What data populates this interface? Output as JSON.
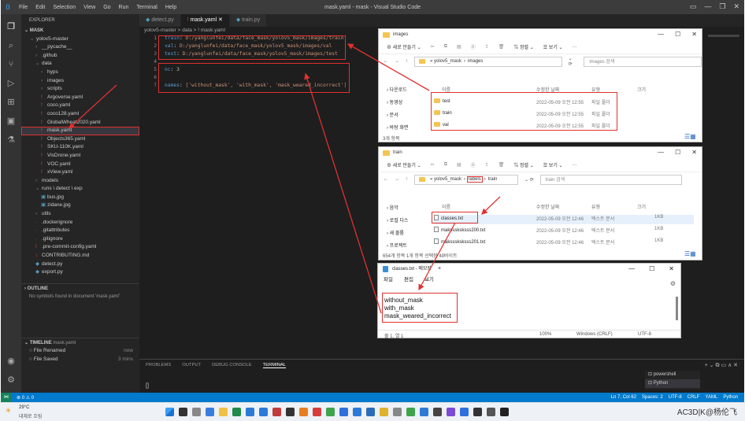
{
  "vscode": {
    "title": "mask.yaml - mask - Visual Studio Code",
    "menu": [
      "File",
      "Edit",
      "Selection",
      "View",
      "Go",
      "Run",
      "Terminal",
      "Help"
    ],
    "explorer_header": "EXPLORER",
    "root": "MASK",
    "tree": [
      {
        "label": "yolov5-master",
        "indent": 1,
        "icon": "chevron-down",
        "kind": "folder"
      },
      {
        "label": "__pycache__",
        "indent": 2,
        "icon": "chevron-right",
        "kind": "folder"
      },
      {
        "label": ".github",
        "indent": 2,
        "icon": "chevron-right",
        "kind": "folder"
      },
      {
        "label": "data",
        "indent": 2,
        "icon": "chevron-down",
        "kind": "folder"
      },
      {
        "label": "hyps",
        "indent": 3,
        "icon": "chevron-right",
        "kind": "folder"
      },
      {
        "label": "images",
        "indent": 3,
        "icon": "chevron-right",
        "kind": "folder"
      },
      {
        "label": "scripts",
        "indent": 3,
        "icon": "chevron-right",
        "kind": "folder"
      },
      {
        "label": "Argoverse.yaml",
        "indent": 3,
        "icon": "!",
        "kind": "yaml"
      },
      {
        "label": "coco.yaml",
        "indent": 3,
        "icon": "!",
        "kind": "yaml"
      },
      {
        "label": "coco128.yaml",
        "indent": 3,
        "icon": "!",
        "kind": "yaml"
      },
      {
        "label": "GlobalWheat2020.yaml",
        "indent": 3,
        "icon": "!",
        "kind": "yaml"
      },
      {
        "label": "mask.yaml",
        "indent": 3,
        "icon": "!",
        "kind": "yaml",
        "selected": true
      },
      {
        "label": "Objects365.yaml",
        "indent": 3,
        "icon": "!",
        "kind": "yaml"
      },
      {
        "label": "SKU-110K.yaml",
        "indent": 3,
        "icon": "!",
        "kind": "yaml"
      },
      {
        "label": "VisDrone.yaml",
        "indent": 3,
        "icon": "!",
        "kind": "yaml"
      },
      {
        "label": "VOC.yaml",
        "indent": 3,
        "icon": "!",
        "kind": "yaml"
      },
      {
        "label": "xView.yaml",
        "indent": 3,
        "icon": "!",
        "kind": "yaml"
      },
      {
        "label": "models",
        "indent": 2,
        "icon": "chevron-right",
        "kind": "folder"
      },
      {
        "label": "runs \\ detect \\ exp",
        "indent": 2,
        "icon": "chevron-down",
        "kind": "folder"
      },
      {
        "label": "bus.jpg",
        "indent": 3,
        "icon": "img",
        "kind": "image"
      },
      {
        "label": "zidane.jpg",
        "indent": 3,
        "icon": "img",
        "kind": "image"
      },
      {
        "label": "utils",
        "indent": 2,
        "icon": "chevron-right",
        "kind": "folder"
      },
      {
        "label": ".dockerignore",
        "indent": 2,
        "icon": "",
        "kind": "file"
      },
      {
        "label": ".gitattributes",
        "indent": 2,
        "icon": "",
        "kind": "file"
      },
      {
        "label": ".gitignore",
        "indent": 2,
        "icon": "",
        "kind": "file"
      },
      {
        "label": ".pre-commit-config.yaml",
        "indent": 2,
        "icon": "!",
        "kind": "yaml"
      },
      {
        "label": "CONTRIBUTING.md",
        "indent": 2,
        "icon": "M",
        "kind": "md"
      },
      {
        "label": "detect.py",
        "indent": 2,
        "icon": "py",
        "kind": "py"
      },
      {
        "label": "export.py",
        "indent": 2,
        "icon": "py",
        "kind": "py"
      }
    ],
    "outline_header": "OUTLINE",
    "outline_empty": "No symbols found in document 'mask.yaml'",
    "timeline_header": "TIMELINE",
    "timeline_file": "mask.yaml",
    "timeline": [
      {
        "label": "File Renamed",
        "time": "now"
      },
      {
        "label": "File Saved",
        "time": "3 mins"
      }
    ],
    "tabs": [
      {
        "label": "detect.py",
        "active": false
      },
      {
        "label": "mask.yaml",
        "active": true
      },
      {
        "label": "train.py",
        "active": false
      }
    ],
    "breadcrumb": "yolov5-master > data > ! mask.yaml",
    "code": [
      {
        "ln": "1",
        "key": "train",
        "val": " D:/yanglunfei/data/face_mask/yolov5_mask/images/train"
      },
      {
        "ln": "2",
        "key": "val",
        "val": " D:/yanglunfei/data/face_mask/yolov5_mask/images/val"
      },
      {
        "ln": "3",
        "key": "test",
        "val": " D:/yanglunfei/data/face_mask/yolov5_mask/images/test"
      },
      {
        "ln": "4",
        "key": "",
        "val": ""
      },
      {
        "ln": "5",
        "key": "nc",
        "val": " 3"
      },
      {
        "ln": "6",
        "key": "",
        "val": ""
      },
      {
        "ln": "7",
        "key": "names",
        "val": " ['without_mask', 'with_mask', 'mask_weared_incorrect']"
      }
    ],
    "panel_tabs": [
      "PROBLEMS",
      "OUTPUT",
      "DEBUG CONSOLE",
      "TERMINAL"
    ],
    "terminal_prompt": "[]",
    "terminals": [
      "powershell",
      "Python"
    ],
    "status_left": "⊗ 0 ⚠ 0",
    "status_right": [
      "Ln 7, Col 62",
      "Spaces: 2",
      "UTF-8",
      "CRLF",
      "YAML",
      "Python"
    ]
  },
  "images_window": {
    "title": "images",
    "new_btn": "새로 만들기",
    "sort": "정렬",
    "view": "보기",
    "address": [
      "« yolov5_mask",
      "images"
    ],
    "search_placeholder": "images 검색",
    "col_name": "이름",
    "col_date": "수정한 날짜",
    "col_type": "유형",
    "col_size": "크기",
    "nav": [
      "다운로드",
      "동영상",
      "문서",
      "바탕 화면"
    ],
    "files": [
      {
        "name": "test",
        "date": "2022-05-09 오전 12:55",
        "type": "파일 폴더"
      },
      {
        "name": "train",
        "date": "2022-05-09 오전 12:55",
        "type": "파일 폴더"
      },
      {
        "name": "val",
        "date": "2022-05-09 오전 12:55",
        "type": "파일 폴더"
      }
    ],
    "status": "3개 항목"
  },
  "train_window": {
    "title": "train",
    "new_btn": "새로 만들기",
    "sort": "정렬",
    "view": "보기",
    "address": [
      "« yolov5_mask",
      "labels",
      "train"
    ],
    "search_placeholder": "train 검색",
    "col_name": "이름",
    "col_date": "수정한 날짜",
    "col_type": "유형",
    "col_size": "크기",
    "nav": [
      "음악",
      "로컬 디스",
      "새 볼륨",
      "프로젝트"
    ],
    "files": [
      {
        "name": "classes.txt",
        "date": "2022-05-09 오전 12:46",
        "type": "텍스트 문서",
        "size": "1KB"
      },
      {
        "name": "maksssksksss200.txt",
        "date": "2022-05-09 오전 12:46",
        "type": "텍스트 문서",
        "size": "1KB"
      },
      {
        "name": "maksssksksss201.txt",
        "date": "2022-05-09 오전 12:46",
        "type": "텍스트 문서",
        "size": "1KB"
      }
    ],
    "status": "654개 항목    1개 항목 선택함 48바이트"
  },
  "notepad": {
    "title": "classes.txt - 메모장",
    "menu": [
      "파일",
      "편집",
      "보기"
    ],
    "lines": [
      "without_mask",
      "with_mask",
      "mask_weared_incorrect"
    ],
    "status": [
      "줄 1, 열 1",
      "100%",
      "Windows (CRLF)",
      "UTF-8"
    ]
  },
  "taskbar": {
    "weather_temp": "29°C",
    "weather_text": "대체로 흐림",
    "watermark": "AC3D|K@杨伦飞"
  },
  "colors": {
    "annotation": "#e03030",
    "vscode_status": "#007acc"
  }
}
